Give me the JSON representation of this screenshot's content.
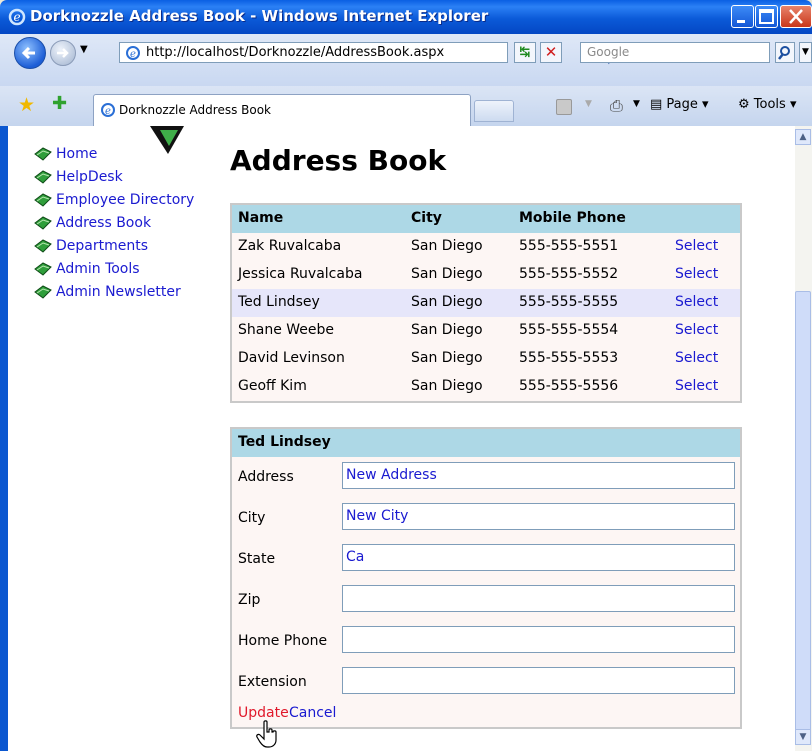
{
  "window": {
    "title": "Dorknozzle Address Book - Windows Internet Explorer"
  },
  "addressbar": {
    "url": "http://localhost/Dorknozzle/AddressBook.aspx",
    "search_placeholder": "Google"
  },
  "tabs": {
    "active_label": "Dorknozzle Address Book"
  },
  "commandbar": {
    "page_label": "Page",
    "tools_label": "Tools"
  },
  "sidebar": {
    "items": [
      {
        "label": "Home"
      },
      {
        "label": "HelpDesk"
      },
      {
        "label": "Employee Directory"
      },
      {
        "label": "Address Book"
      },
      {
        "label": "Departments"
      },
      {
        "label": "Admin Tools"
      },
      {
        "label": "Admin Newsletter"
      }
    ]
  },
  "page": {
    "title": "Address Book"
  },
  "grid": {
    "headers": [
      "Name",
      "City",
      "Mobile Phone",
      ""
    ],
    "select_label": "Select",
    "rows": [
      {
        "name": "Zak Ruvalcaba",
        "city": "San Diego",
        "phone": "555-555-5551"
      },
      {
        "name": "Jessica Ruvalcaba",
        "city": "San Diego",
        "phone": "555-555-5552"
      },
      {
        "name": "Ted Lindsey",
        "city": "San Diego",
        "phone": "555-555-5555"
      },
      {
        "name": "Shane Weebe",
        "city": "San Diego",
        "phone": "555-555-5554"
      },
      {
        "name": "David Levinson",
        "city": "San Diego",
        "phone": "555-555-5553"
      },
      {
        "name": "Geoff Kim",
        "city": "San Diego",
        "phone": "555-555-5556"
      }
    ],
    "selected_row": 2
  },
  "details": {
    "header": "Ted Lindsey",
    "fields": [
      {
        "label": "Address",
        "value": "New Address"
      },
      {
        "label": "City",
        "value": "New City"
      },
      {
        "label": "State",
        "value": "Ca"
      },
      {
        "label": "Zip",
        "value": ""
      },
      {
        "label": "Home Phone",
        "value": ""
      },
      {
        "label": "Extension",
        "value": ""
      }
    ],
    "update_label": "Update",
    "cancel_label": "Cancel"
  },
  "colors": {
    "header_bg": "#add8e6",
    "selected_row_bg": "#e6e6fa",
    "link": "#1a1ad0",
    "update_link": "#e0182a"
  }
}
